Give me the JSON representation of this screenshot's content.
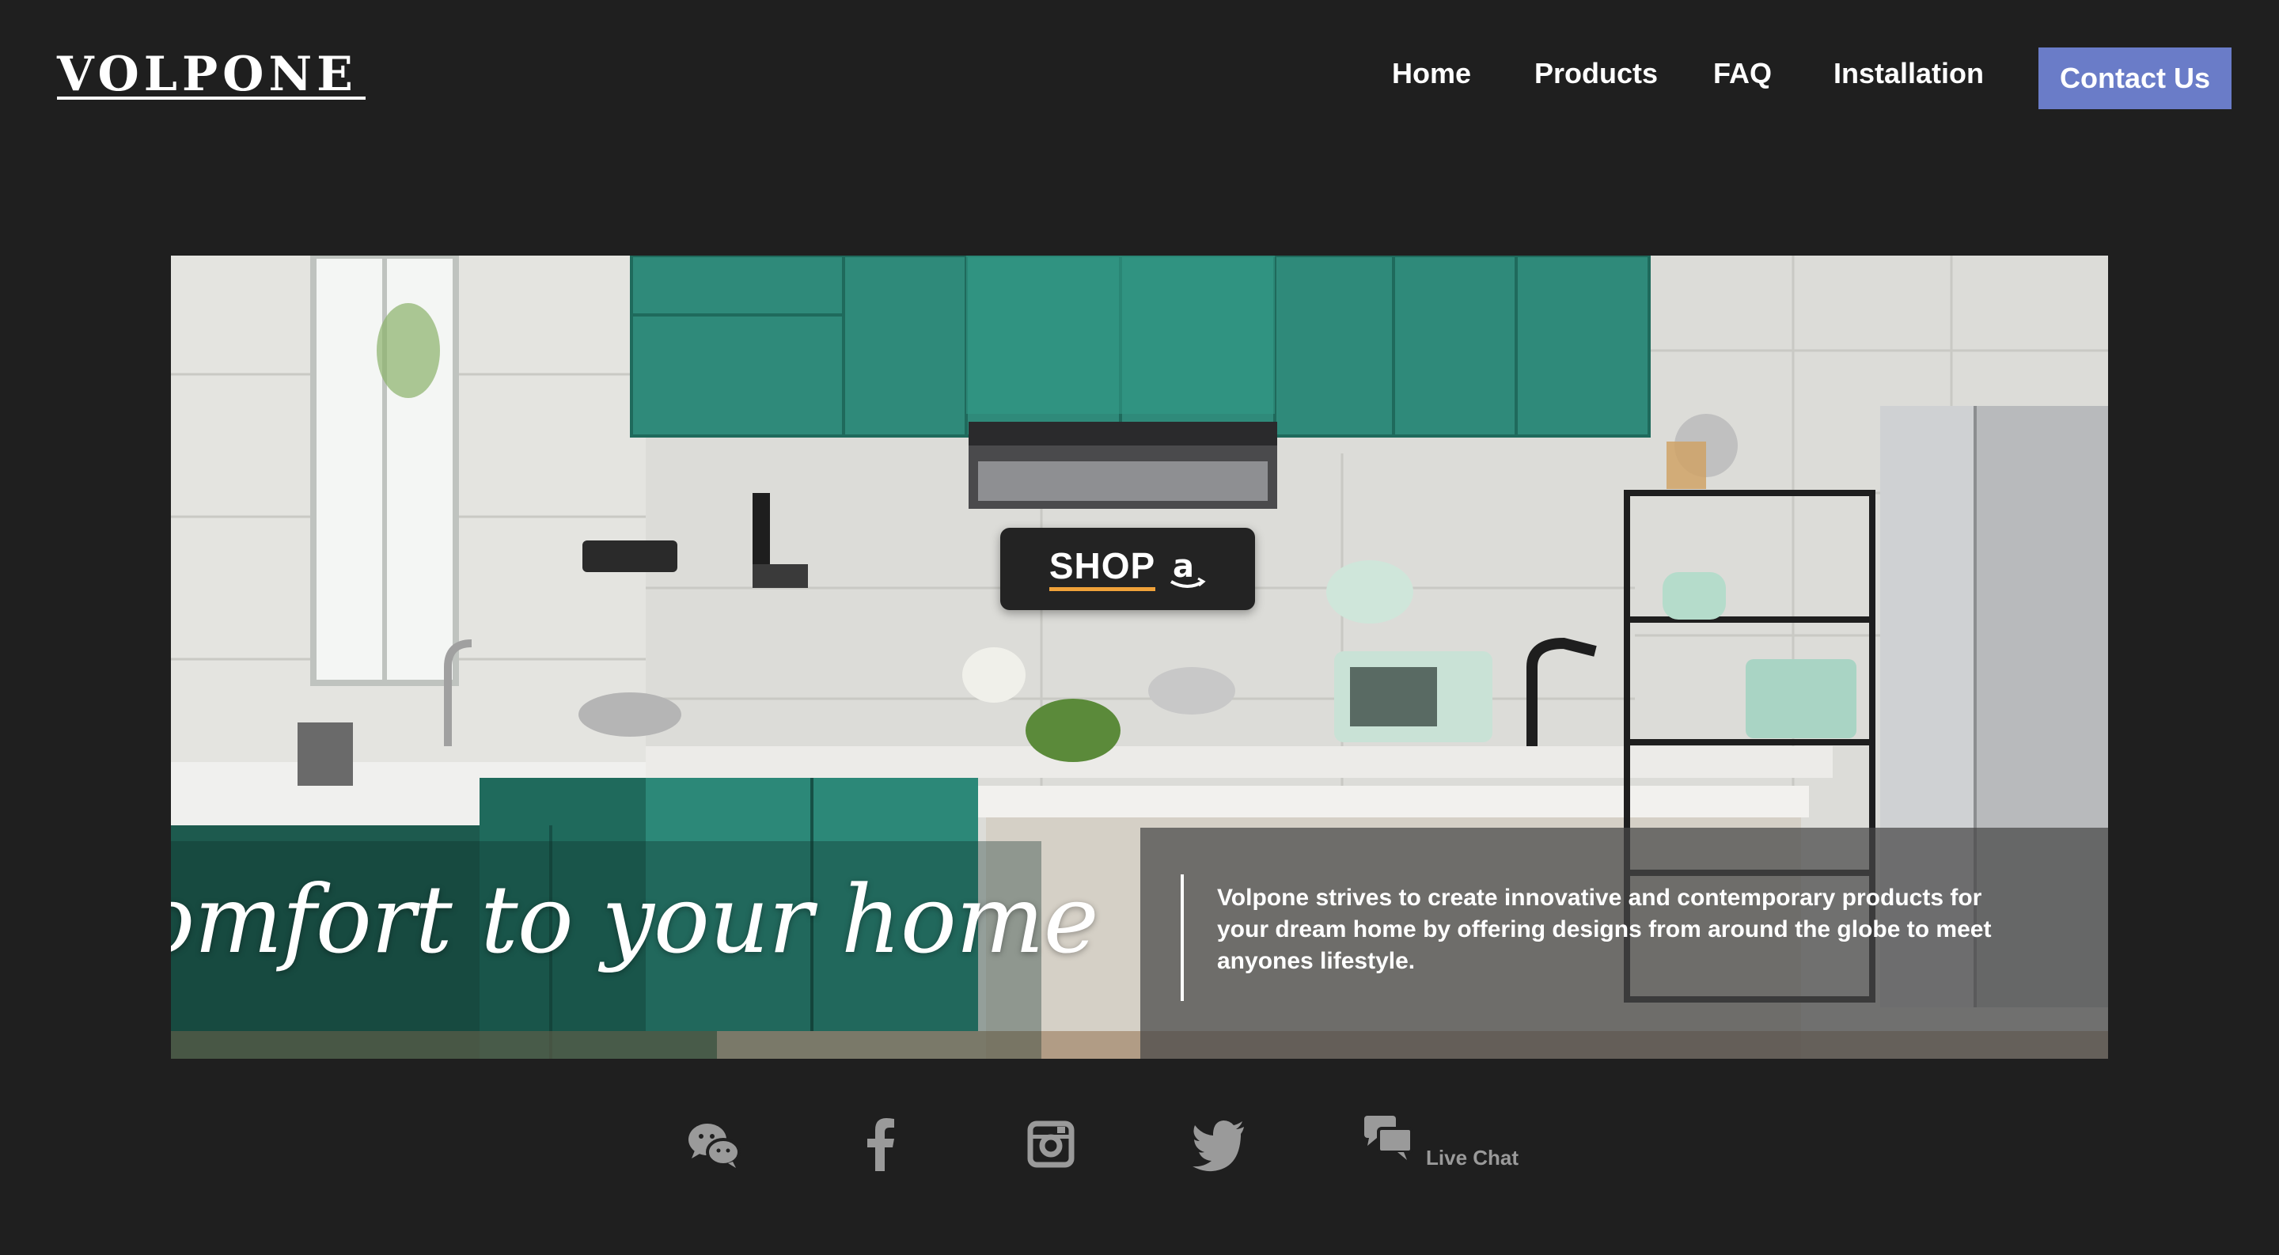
{
  "brand": {
    "name": "VOLPONE",
    "accent_color": "#6a7cc8"
  },
  "nav": {
    "items": [
      {
        "label": "Home"
      },
      {
        "label": "Products"
      },
      {
        "label": "FAQ"
      },
      {
        "label": "Installation"
      }
    ],
    "contact_label": "Contact Us"
  },
  "hero": {
    "shop_label": "SHOP",
    "shop_icon": "amazon-icon",
    "tagline": "Comfort to your home",
    "description": "Volpone strives to create innovative and contemporary products for your dream home by offering designs from around the globe to meet anyones lifestyle."
  },
  "social": {
    "icons": [
      "wechat-icon",
      "facebook-icon",
      "instagram-icon",
      "twitter-icon",
      "chat-icon"
    ],
    "live_chat_label": "Live Chat",
    "icon_color": "#9a9a9a"
  }
}
